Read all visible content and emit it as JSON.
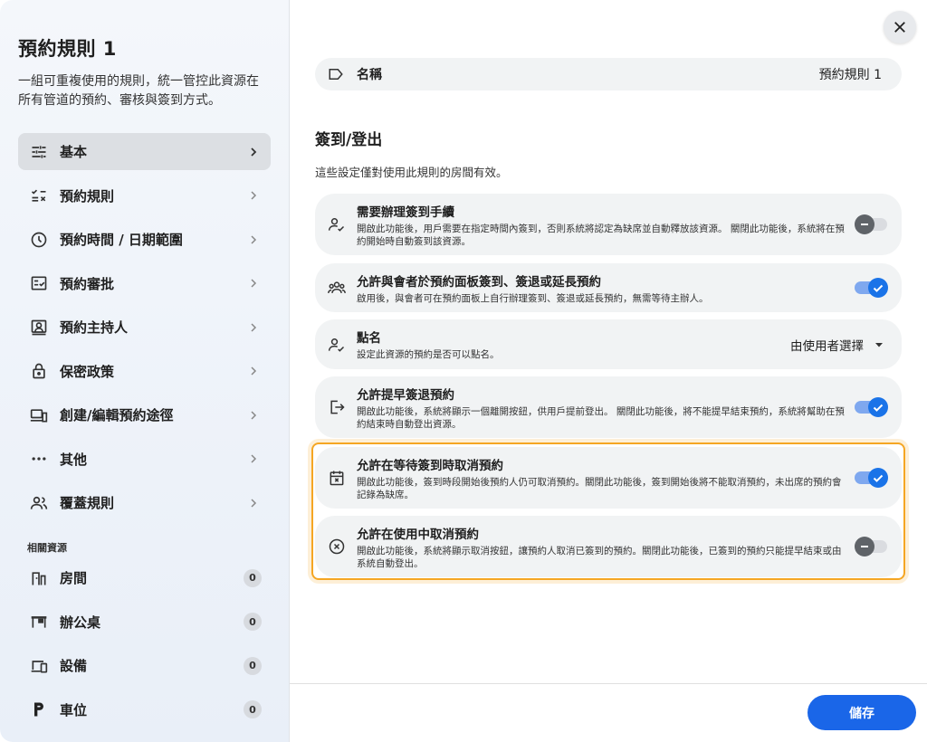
{
  "sidebar": {
    "title": "預約規則 1",
    "description": "一組可重複使用的規則，統一管控此資源在所有管道的預約、審核與簽到方式。",
    "items": [
      {
        "label": "基本",
        "icon": "sliders-icon",
        "active": true
      },
      {
        "label": "預約規則",
        "icon": "checklist-icon"
      },
      {
        "label": "預約時間 / 日期範圍",
        "icon": "clock-icon"
      },
      {
        "label": "預約審批",
        "icon": "approval-icon"
      },
      {
        "label": "預約主持人",
        "icon": "host-icon"
      },
      {
        "label": "保密政策",
        "icon": "lock-icon"
      },
      {
        "label": "創建/編輯預約途徑",
        "icon": "devices-icon"
      },
      {
        "label": "其他",
        "icon": "more-icon"
      },
      {
        "label": "覆蓋規則",
        "icon": "people-icon"
      }
    ],
    "related_title": "相關資源",
    "related": [
      {
        "label": "房間",
        "count": "0",
        "icon": "room-icon"
      },
      {
        "label": "辦公桌",
        "count": "0",
        "icon": "desk-icon"
      },
      {
        "label": "設備",
        "count": "0",
        "icon": "equipment-icon"
      },
      {
        "label": "車位",
        "count": "0",
        "icon": "parking-icon"
      }
    ]
  },
  "main": {
    "name_label": "名稱",
    "name_value": "預約規則 1",
    "section_title": "簽到/登出",
    "section_subtitle": "這些設定僅對使用此規則的房間有效。",
    "settings": [
      {
        "title": "需要辦理簽到手續",
        "desc": "開啟此功能後，用戶需要在指定時間內簽到，否則系統將認定為缺席並自動釋放該資源。 關閉此功能後，系統將在預約開始時自動簽到該資源。",
        "state": "off"
      },
      {
        "title": "允許與會者於預約面板簽到、簽退或延長預約",
        "desc": "啟用後，與會者可在預約面板上自行辦理簽到、簽退或延長預約，無需等待主辦人。",
        "state": "on"
      },
      {
        "title": "點名",
        "desc": "設定此資源的預約是否可以點名。",
        "select_value": "由使用者選擇"
      },
      {
        "title": "允許提早簽退預約",
        "desc": "開啟此功能後，系統將顯示一個離開按鈕，供用戶提前登出。 關閉此功能後，將不能提早結束預約，系統將幫助在預約結束時自動登出資源。",
        "state": "on"
      },
      {
        "title": "允許在等待簽到時取消預約",
        "desc": "開啟此功能後，簽到時段開始後預約人仍可取消預約。關閉此功能後，簽到開始後將不能取消預約，未出席的預約會記錄為缺席。",
        "state": "on"
      },
      {
        "title": "允許在使用中取消預約",
        "desc": "開啟此功能後，系統將顯示取消按鈕，讓預約人取消已簽到的預約。關閉此功能後，已簽到的預約只能提早結束或由系統自動登出。",
        "state": "off"
      }
    ],
    "save_label": "儲存"
  },
  "colors": {
    "accent": "#1a66e8",
    "highlight": "#f5a623",
    "card_bg": "#f1f3f4",
    "sidebar_active": "#dcdfe3"
  }
}
